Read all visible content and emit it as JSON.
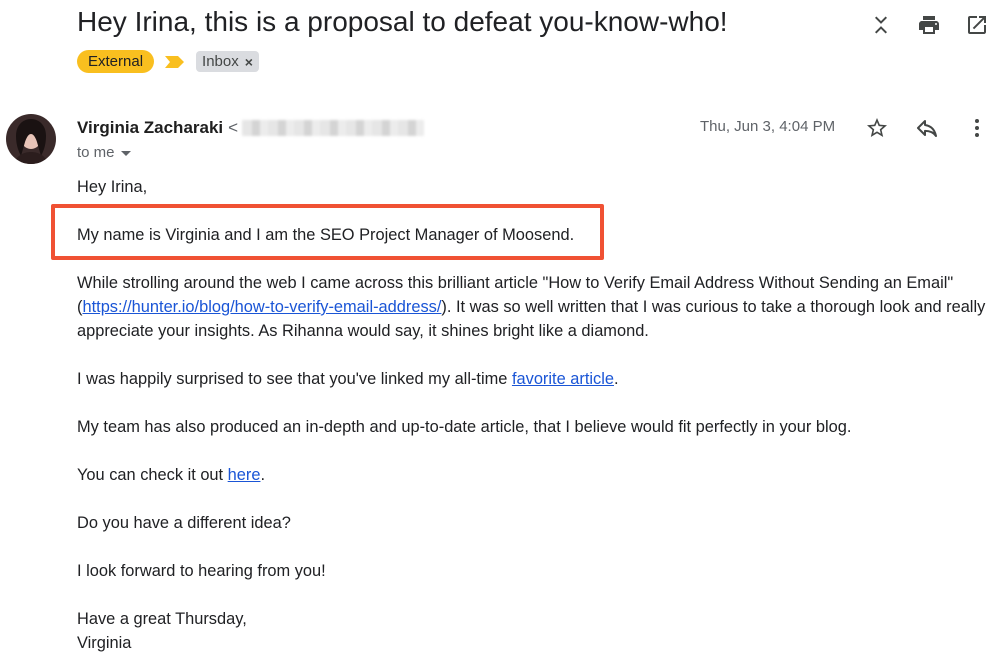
{
  "subject": "Hey Irina, this is a proposal to defeat you-know-who!",
  "labels": {
    "external": "External",
    "inbox": "Inbox",
    "remove": "×"
  },
  "sender": {
    "name": "Virginia Zacharaki",
    "email_prefix": "<",
    "to": "to me"
  },
  "date": "Thu, Jun 3, 4:04 PM",
  "body": {
    "greeting": "Hey Irina,",
    "intro": "My name is Virginia and I am the SEO Project Manager of Moosend.",
    "p1_a": "While strolling around the web I came across this brilliant article \"How to Verify Email Address Without Sending an Email\" (",
    "p1_link": "https://hunter.io/blog/how-to-verify-email-address/",
    "p1_b": "). It was so well written that I was curious to take a thorough look and really appreciate your insights. As Rihanna would say, it shines bright like a diamond.",
    "p2_a": "I was happily surprised to see that you've linked my all-time ",
    "p2_link": "favorite article",
    "p2_b": ".",
    "p3": "My team has also produced an in-depth and up-to-date article, that I believe would fit perfectly in your blog.",
    "p4_a": "You can check it out ",
    "p4_link": "here",
    "p4_b": ".",
    "p5": "Do you have a different idea?",
    "p6": "I look forward to hearing from you!",
    "signoff": "Have a great Thursday,",
    "signature": "Virginia"
  },
  "icons": {
    "collapse": "collapse-icon",
    "print": "print-icon",
    "open_new_window": "open-in-new-window-icon",
    "star": "star-icon",
    "reply": "reply-icon",
    "more": "more-vert-icon",
    "important": "important-marker-icon"
  },
  "colors": {
    "external_label": "#f9bf1f",
    "highlight_box": "#f05133",
    "link": "#1a55d6"
  }
}
